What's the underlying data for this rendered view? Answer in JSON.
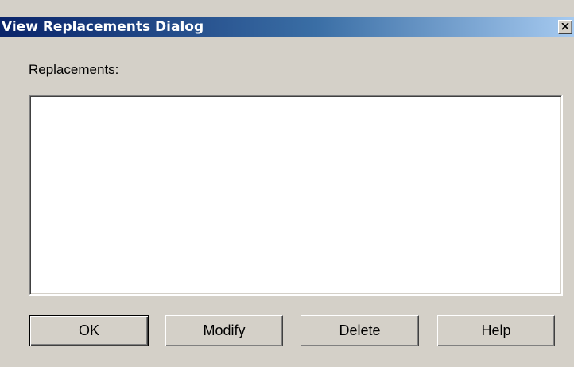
{
  "window": {
    "title": "View Replacements Dialog",
    "close_glyph": "close-icon"
  },
  "replacements": {
    "label": "Replacements:",
    "items": []
  },
  "buttons": {
    "ok": "OK",
    "modify": "Modify",
    "delete": "Delete",
    "help": "Help"
  },
  "colors": {
    "dialog_face": "#d4d0c8",
    "title_gradient_start": "#0a246a",
    "title_gradient_end": "#a6caf0",
    "list_background": "#ffffff"
  }
}
